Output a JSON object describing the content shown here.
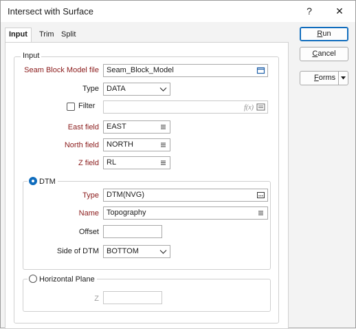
{
  "window": {
    "title": "Intersect with Surface",
    "help_glyph": "?",
    "close_glyph": "✕"
  },
  "tabs": [
    {
      "label": "Input"
    },
    {
      "label": "Trim"
    },
    {
      "label": "Split"
    }
  ],
  "buttons": {
    "run": {
      "first": "R",
      "rest": "un"
    },
    "cancel": {
      "first": "C",
      "rest": "ancel"
    },
    "forms": {
      "first": "F",
      "rest": "orms"
    }
  },
  "input_group": {
    "legend": "Input",
    "seam_block_model_file": {
      "label": "Seam Block Model file",
      "value": "Seam_Block_Model"
    },
    "type": {
      "label": "Type",
      "value": "DATA"
    },
    "filter": {
      "label": "Filter",
      "value": "",
      "checked": false,
      "icon_text": "f(x)"
    },
    "east_field": {
      "label": "East field",
      "value": "EAST"
    },
    "north_field": {
      "label": "North field",
      "value": "NORTH"
    },
    "z_field": {
      "label": "Z field",
      "value": "RL"
    }
  },
  "dtm_group": {
    "legend": "DTM",
    "selected": true,
    "type": {
      "label": "Type",
      "value": "DTM(NVG)"
    },
    "name": {
      "label": "Name",
      "value": "Topography"
    },
    "offset": {
      "label": "Offset",
      "value": ""
    },
    "side_of_dtm": {
      "label": "Side of DTM",
      "value": "BOTTOM"
    }
  },
  "horizontal_plane_group": {
    "legend": "Horizontal Plane",
    "selected": false,
    "z": {
      "label": "Z",
      "value": ""
    }
  },
  "icons": [
    "file-browse-icon",
    "chevron-down-icon",
    "list-icon",
    "function-icon",
    "ellipsis-icon",
    "radio-icon",
    "checkbox-icon"
  ]
}
